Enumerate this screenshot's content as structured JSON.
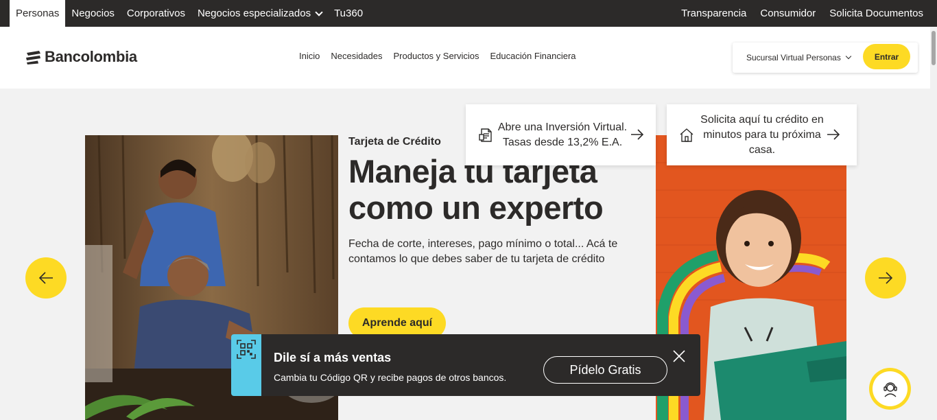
{
  "topbar": {
    "left_items": [
      {
        "label": "Personas",
        "active": true
      },
      {
        "label": "Negocios"
      },
      {
        "label": "Corporativos"
      },
      {
        "label": "Negocios especializados"
      },
      {
        "label": "Tu360"
      }
    ],
    "right_items": [
      {
        "label": "Transparencia"
      },
      {
        "label": "Consumidor"
      },
      {
        "label": "Solicita Documentos"
      }
    ]
  },
  "header": {
    "logo_text": "Bancolombia",
    "nav": [
      "Inicio",
      "Necesidades",
      "Productos y Servicios",
      "Educación Financiera"
    ],
    "sucursal_label": "Sucursal Virtual Personas",
    "entrar_label": "Entrar"
  },
  "hero": {
    "kicker": "Tarjeta de Crédito",
    "headline": "Maneja tu tarjeta como un experto",
    "subtext": "Fecha de corte, intereses, pago mínimo o total... Acá te contamos lo que debes saber de tu tarjeta de crédito",
    "cta_label": "Aprende aquí"
  },
  "cards": [
    {
      "text": "Abre una Inversión Virtual. Tasas desde 13,2% E.A.",
      "icon": "document-icon"
    },
    {
      "text": "Solicita aquí tu crédito en minutos para tu próxima casa.",
      "icon": "house-icon"
    }
  ],
  "promo": {
    "title": "Dile sí a más ventas",
    "subtitle": "Cambia tu Código QR y recibe pagos de otros bancos.",
    "button_label": "Pídelo Gratis",
    "icon": "qr-code-icon"
  },
  "colors": {
    "brand_yellow": "#fdda24",
    "dark": "#2c2a29",
    "promo_accent": "#59cbe8"
  }
}
